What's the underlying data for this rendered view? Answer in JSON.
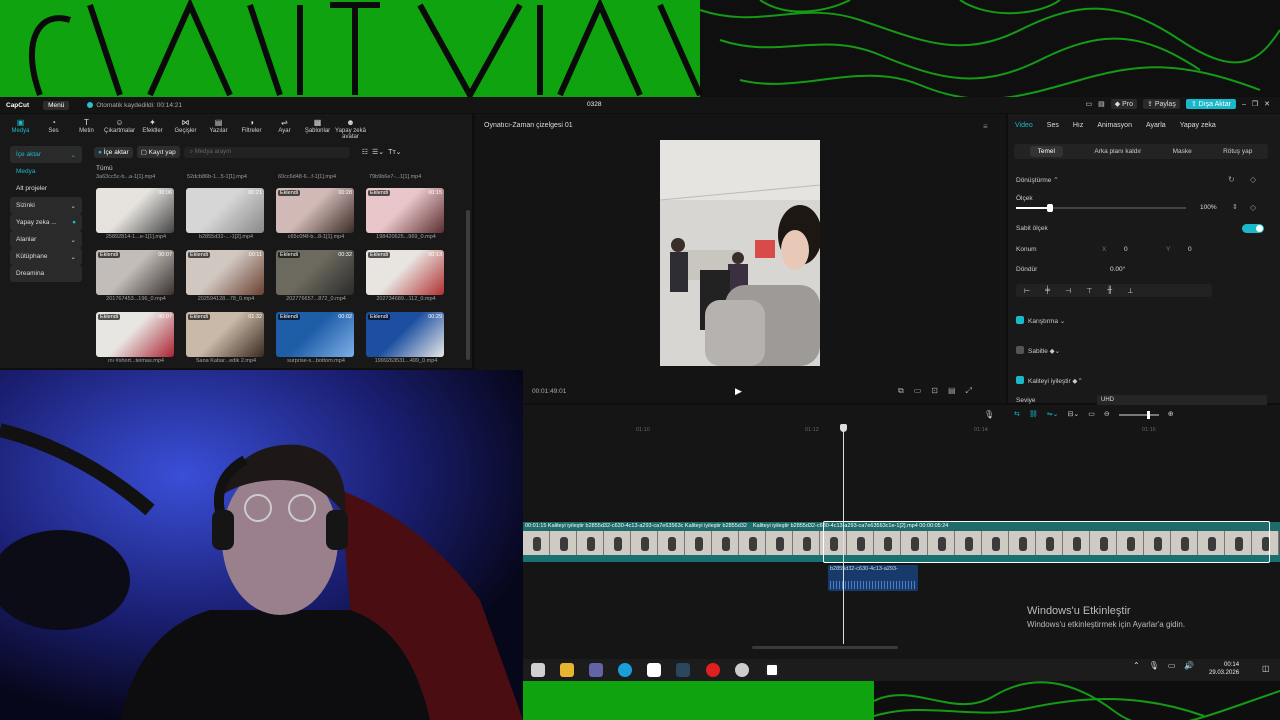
{
  "app": {
    "logo": "CapCut",
    "menu_label": "Menü",
    "autosave": "Otomatik kaydedildi: 00:14:21",
    "project_name": "0328"
  },
  "topbar": {
    "pro": "Pro",
    "share": "Paylaş",
    "export": "Dışa Aktar"
  },
  "toolbar": [
    {
      "label": "Medya",
      "icon": "media-icon"
    },
    {
      "label": "Ses",
      "icon": "audio-icon"
    },
    {
      "label": "Metin",
      "icon": "text-icon"
    },
    {
      "label": "Çıkartmalar",
      "icon": "sticker-icon"
    },
    {
      "label": "Efektler",
      "icon": "effects-icon"
    },
    {
      "label": "Geçişler",
      "icon": "transitions-icon"
    },
    {
      "label": "Yazılar",
      "icon": "captions-icon"
    },
    {
      "label": "Filtreler",
      "icon": "filters-icon"
    },
    {
      "label": "Ayar",
      "icon": "adjust-icon"
    },
    {
      "label": "Şablonlar",
      "icon": "templates-icon"
    },
    {
      "label": "Yapay zekâ avatar",
      "icon": "ai-avatar-icon"
    }
  ],
  "sidebar": {
    "items": [
      "İçe aktar",
      "Medya",
      "Alt projeler",
      "Sizinki",
      "Yapay zeka ...",
      "Alanlar",
      "Kütüphane",
      "Dreamina"
    ]
  },
  "media": {
    "import_label": "İçe aktar",
    "record_label": "Kayıt yap",
    "search_placeholder": "Medya arayın",
    "all_label": "Tümü",
    "top_names": [
      "3a63cc5c-b...a-1[1].mp4",
      "52dcb86b-1...5-1[1].mp4",
      "60cc6d48-6...f-1[1].mp4",
      "79b9b6e7-...1[1].mp4"
    ],
    "items": [
      {
        "tag": "",
        "dur": "00:06",
        "name": "25892814-1...e-1[1].mp4"
      },
      {
        "tag": "",
        "dur": "00:21",
        "name": "b2855d32-...-1[2].mp4"
      },
      {
        "tag": "Eklendi",
        "dur": "00:28",
        "name": "c65c0f4f-b...8-1[1].mp4"
      },
      {
        "tag": "Eklendi",
        "dur": "00:15",
        "name": "198420625...969_0.mp4"
      },
      {
        "tag": "Eklendi",
        "dur": "00:07",
        "name": "201767453...196_0.mp4"
      },
      {
        "tag": "Eklendi",
        "dur": "00:11",
        "name": "202594128...78_0.mp4"
      },
      {
        "tag": "Eklendi",
        "dur": "00:32",
        "name": "202776657...872_0.mp4"
      },
      {
        "tag": "Eklendi",
        "dur": "00:13",
        "name": "202734689...112_0.mp4"
      },
      {
        "tag": "Eklendi",
        "dur": "00:07",
        "name": "ını #short...teimas.mp4"
      },
      {
        "tag": "Eklendi",
        "dur": "01:32",
        "name": "Sana Kabar...edik 2.mp4"
      },
      {
        "tag": "Eklendi",
        "dur": "00:02",
        "name": "surprise-s...bottom.mp4"
      },
      {
        "tag": "Eklendi",
        "dur": "00:29",
        "name": "1999263531...499_0.mp4"
      }
    ]
  },
  "player": {
    "title": "Oynatıcı-Zaman çizelgesi 01",
    "timecode": "00:01:49:01"
  },
  "right": {
    "tabs": [
      "Video",
      "Ses",
      "Hız",
      "Animasyon",
      "Ayarla",
      "Yapay zeka"
    ],
    "subtabs": [
      "Temel",
      "Arka planı kaldır",
      "Maske",
      "Rötuş yap"
    ],
    "transform": "Dönüştürme",
    "scale_label": "Ölçek",
    "scale_value": "100%",
    "scale_level": 0.2,
    "uniform_scale": "Sabit ölçek",
    "position_label": "Konum",
    "pos_x_label": "X",
    "pos_x": "0",
    "pos_y_label": "Y",
    "pos_y": "0",
    "rotate_label": "Döndür",
    "rotate_value": "0.00°",
    "blend": "Karıştırma",
    "stabilize": "Sabitle",
    "enhance": "Kaliteyi iyileştir",
    "level_label": "Seviye",
    "level_value": "UHD"
  },
  "timeline": {
    "ruler": [
      "01:10",
      "01:12",
      "01:14",
      "01:16"
    ],
    "clip_label_left": "00:01:15   Kaliteyi iyileştir   b2855d32-c630-4c13-a293-ca7e63563c   Kaliteyi iyileştir   b2855d32",
    "clip_label_right": "Kaliteyi iyileştir   b2855d32-c630-4c13-a293-ca7e63563c1e-1[2].mp4   00:00:05:24",
    "audio_label": "b2855d32-c630-4c13-a293-"
  },
  "watermark": {
    "title": "Windows'u Etkinleştir",
    "subtitle": "Windows'u etkinleştirmek için Ayarlar'a gidin."
  },
  "taskbar": {
    "time": "00:14",
    "date": "29.03.2026"
  },
  "colors": {
    "accent": "#19b9c9",
    "banner_green": "#0fa30f"
  }
}
